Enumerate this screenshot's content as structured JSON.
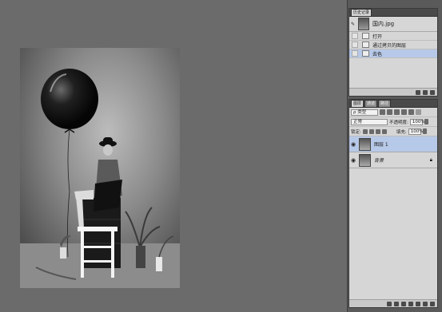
{
  "history_panel": {
    "tab_label": "历史记录",
    "snapshot_name": "国内.jpg",
    "steps": [
      {
        "label": "打开",
        "selected": false
      },
      {
        "label": "通过拷贝的图层",
        "selected": false
      },
      {
        "label": "去色",
        "selected": true
      }
    ]
  },
  "layers_panel": {
    "tabs": [
      "图层",
      "通道",
      "路径"
    ],
    "active_tab": 0,
    "filter_label": "ρ 类型",
    "blend_mode": "正常",
    "opacity_label": "不透明度:",
    "opacity_value": "100%",
    "lock_label": "锁定:",
    "fill_label": "填充:",
    "fill_value": "100%",
    "layers": [
      {
        "name": "图层 1",
        "selected": true
      },
      {
        "name": "背景",
        "selected": false
      }
    ]
  }
}
